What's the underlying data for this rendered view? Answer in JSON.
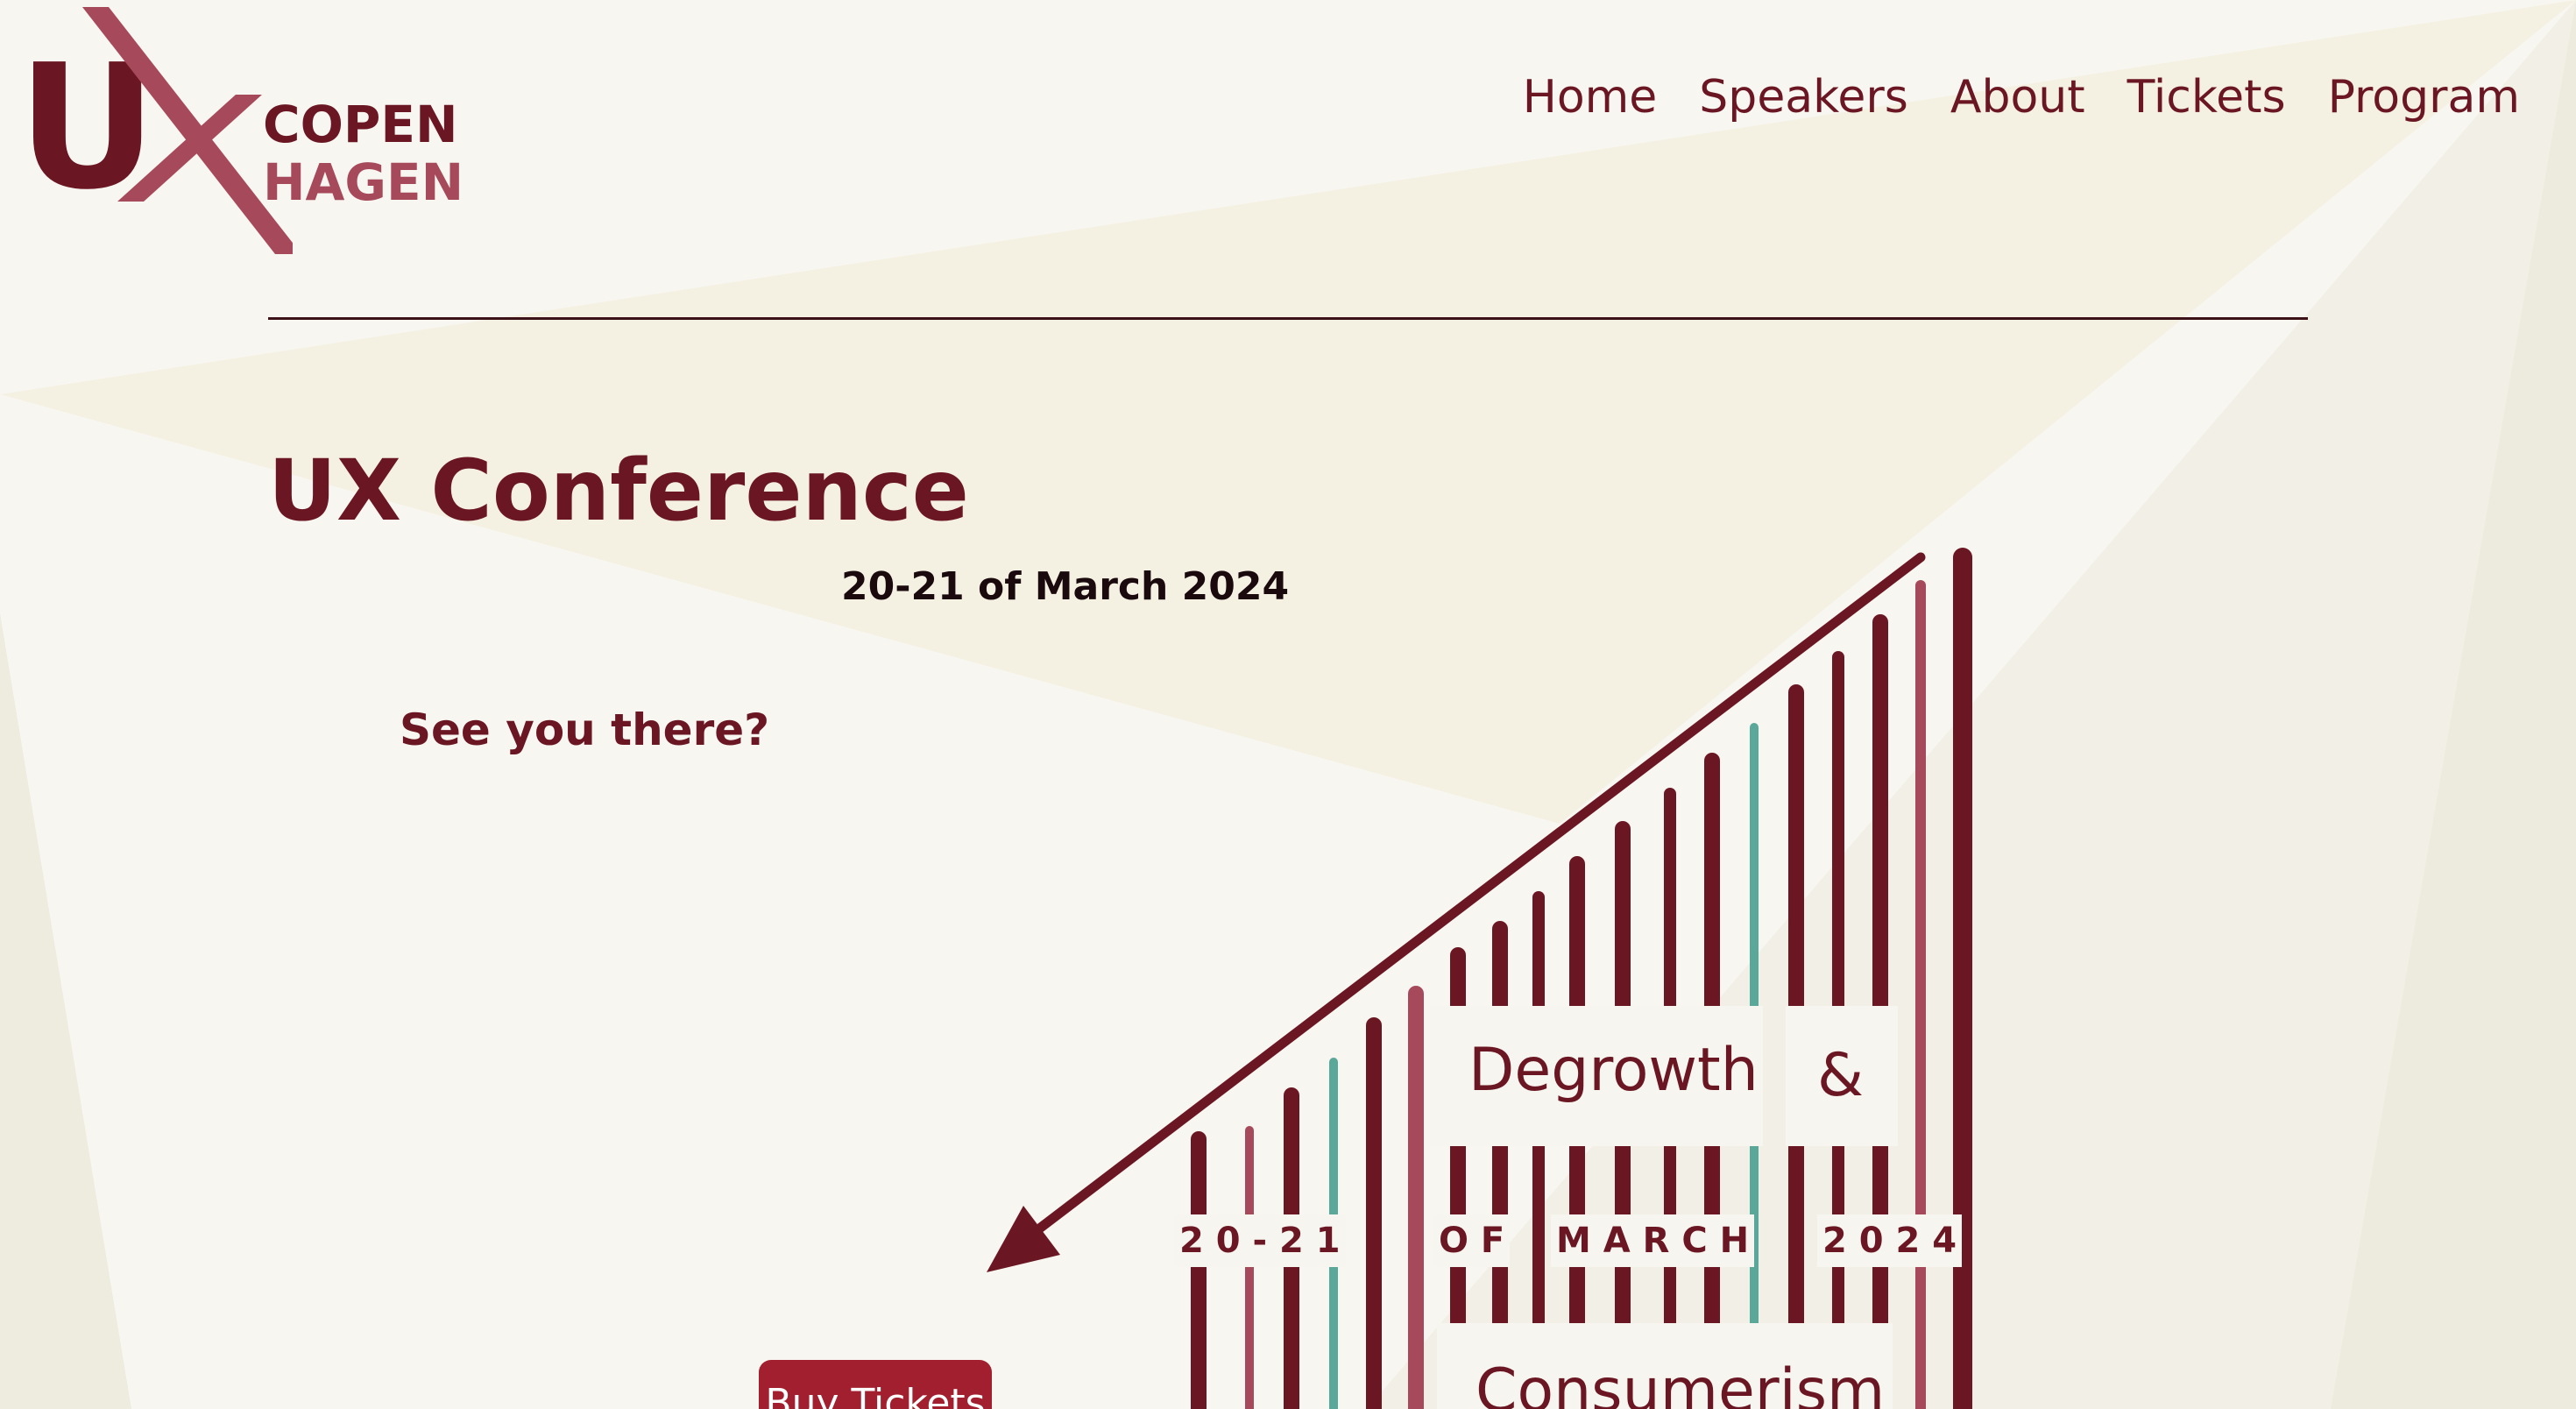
{
  "logo": {
    "letter_u": "U",
    "letter_x": "X",
    "word_top": "COPEN",
    "word_bottom": "HAGEN"
  },
  "nav": {
    "items": [
      "Home",
      "Speakers",
      "About",
      "Tickets",
      "Program"
    ]
  },
  "hero": {
    "title": "UX Conference",
    "date": "20-21 of March 2024",
    "tagline": "See you there?",
    "buy_button": "Buy Tickets"
  },
  "poster": {
    "word_1": "Degrowth",
    "word_2": "&",
    "word_3": "Consumerism",
    "date_strip": [
      "2 0 - 2 1",
      "O F",
      "M A R C H",
      "2 0 2 4"
    ]
  },
  "colors": {
    "brand_dark": "#6b1723",
    "brand_rose": "#a64a5b",
    "accent_teal": "#5aa89a",
    "button": "#a11f2e",
    "background": "#f8f6f1"
  }
}
